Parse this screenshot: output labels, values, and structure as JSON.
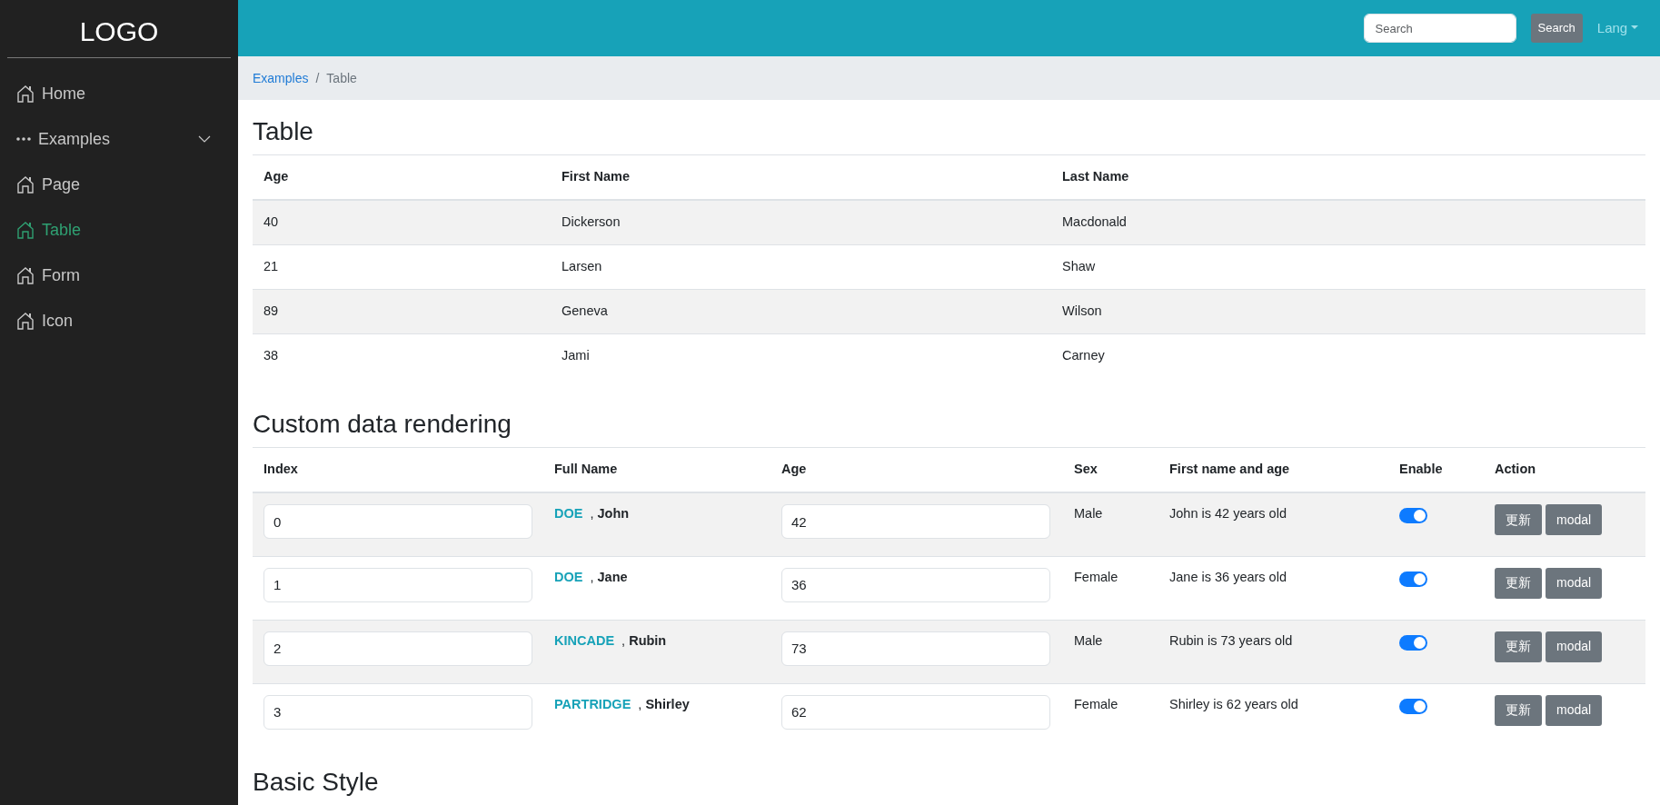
{
  "sidebar": {
    "logo": "LOGO",
    "items": [
      {
        "label": "Home",
        "kind": "link",
        "selected": false
      },
      {
        "label": "Examples",
        "kind": "group",
        "selected": false,
        "expanded": false
      },
      {
        "label": "Page",
        "kind": "link",
        "selected": false
      },
      {
        "label": "Table",
        "kind": "link",
        "selected": true
      },
      {
        "label": "Form",
        "kind": "link",
        "selected": false
      },
      {
        "label": "Icon",
        "kind": "link",
        "selected": false
      }
    ]
  },
  "navbar": {
    "search": {
      "placeholder": "Search"
    },
    "search_button": "Search",
    "lang_menu": "Lang"
  },
  "breadcrumb": {
    "separator": "/",
    "items": [
      {
        "label": "Examples",
        "selected": false
      },
      {
        "label": "Table",
        "selected": true
      }
    ]
  },
  "table": {
    "title": "Table",
    "columns": [
      "Age",
      "First Name",
      "Last Name"
    ],
    "rows": [
      [
        "40",
        "Dickerson",
        "Macdonald"
      ],
      [
        "21",
        "Larsen",
        "Shaw"
      ],
      [
        "89",
        "Geneva",
        "Wilson"
      ],
      [
        "38",
        "Jami",
        "Carney"
      ]
    ]
  },
  "custom_table": {
    "title": "Custom data rendering",
    "columns": [
      "Index",
      "Full Name",
      "Age",
      "Sex",
      "First name and age",
      "Enable",
      "Action"
    ],
    "rows": [
      {
        "index": "0",
        "last_name": "DOE",
        "first_name": ", **John**",
        "age": "42",
        "sex": "Male",
        "summary": "John is 42 years old",
        "enabled": true,
        "actions": [
          "更新",
          "modal"
        ]
      },
      {
        "index": "1",
        "last_name": "DOE",
        "first_name": ", **Jane**",
        "age": "36",
        "sex": "Female",
        "summary": "Jane is 36 years old",
        "enabled": true,
        "actions": [
          "更新",
          "modal"
        ]
      },
      {
        "index": "2",
        "last_name": "KINCADE",
        "first_name": ", **Rubin**",
        "age": "73",
        "sex": "Male",
        "summary": "Rubin is 73 years old",
        "enabled": true,
        "actions": [
          "更新",
          "modal"
        ]
      },
      {
        "index": "3",
        "last_name": "PARTRIDGE",
        "first_name": ", **Shirley**",
        "age": "62",
        "sex": "Female",
        "summary": "Shirley is 62 years old",
        "enabled": true,
        "actions": [
          "更新",
          "modal"
        ]
      }
    ]
  },
  "next_section": {
    "title": "Basic Style"
  }
}
